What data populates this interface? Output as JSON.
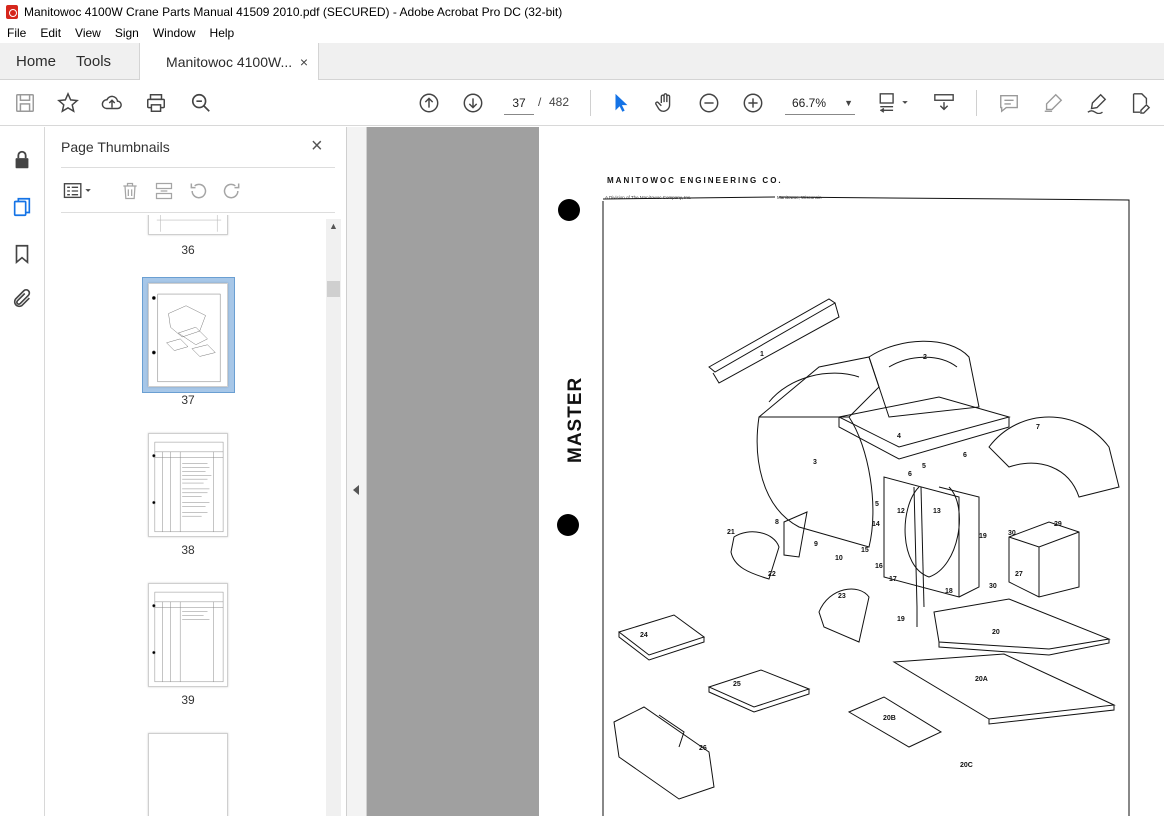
{
  "window": {
    "title": "Manitowoc 4100W Crane Parts Manual 41509 2010.pdf (SECURED) - Adobe Acrobat Pro DC (32-bit)"
  },
  "menu": [
    "File",
    "Edit",
    "View",
    "Sign",
    "Window",
    "Help"
  ],
  "tabs": {
    "home": "Home",
    "tools": "Tools",
    "document": "Manitowoc 4100W...",
    "close_glyph": "×"
  },
  "toolbar": {
    "current_page": "37",
    "separator": "/",
    "total_pages": "482",
    "zoom": "66.7%"
  },
  "thumbnails_panel": {
    "title": "Page Thumbnails",
    "close_glyph": "×",
    "pages": [
      "36",
      "37",
      "38",
      "39"
    ],
    "selected_page": "37"
  },
  "document_page": {
    "company": "MANITOWOC ENGINEERING CO.",
    "division": "A Division of The Manitowoc Company, Inc.",
    "city": "Manitowoc, Wisconsin",
    "stamp": "MASTER",
    "part_labels": [
      "1",
      "2",
      "3",
      "4",
      "5",
      "5",
      "6",
      "6",
      "7",
      "8",
      "9",
      "10",
      "12",
      "13",
      "14",
      "15",
      "16",
      "17",
      "18",
      "19",
      "19",
      "20",
      "20A",
      "20B",
      "20C",
      "21",
      "22",
      "23",
      "24",
      "25",
      "26",
      "27",
      "29",
      "30",
      "30"
    ]
  },
  "icons": {
    "toolbar": [
      "save-icon",
      "bookmark-star-icon",
      "upload-icon",
      "print-icon",
      "zoom-search-icon",
      "page-up-icon",
      "page-down-icon",
      "select-arrow-icon",
      "hand-icon",
      "zoom-out-icon",
      "zoom-in-icon",
      "fit-page-icon",
      "scroll-mode-icon",
      "comment-icon",
      "highlight-icon",
      "sign-icon",
      "edit-pdf-icon"
    ],
    "left_rail": [
      "lock-icon",
      "pages-icon",
      "bookmark-icon",
      "attachment-icon"
    ]
  },
  "colors": {
    "accent": "#1473e6",
    "selection": "#a7c7e8",
    "doc_background": "#a0a0a0"
  }
}
